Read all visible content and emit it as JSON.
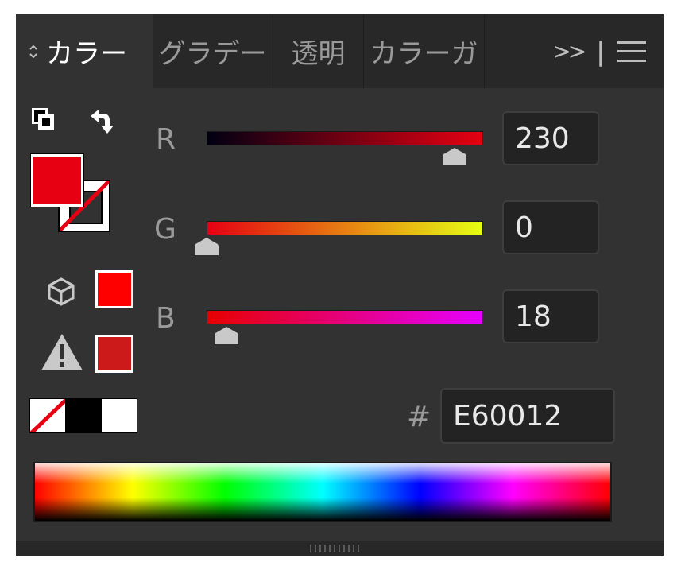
{
  "tabs": [
    {
      "label": "カラー",
      "active": true
    },
    {
      "label": "グラデー",
      "active": false
    },
    {
      "label": "透明",
      "active": false
    },
    {
      "label": "カラーガ",
      "active": false
    }
  ],
  "tab_menu": {
    "more_label": ">>",
    "separator": "|",
    "menu_icon": "hamburger-menu-icon"
  },
  "channels": [
    {
      "label": "R",
      "value": "230",
      "fraction": 0.902
    },
    {
      "label": "G",
      "value": "0",
      "fraction": 0.0
    },
    {
      "label": "B",
      "value": "18",
      "fraction": 0.071
    }
  ],
  "hex": {
    "prefix": "#",
    "value": "E60012"
  },
  "colors": {
    "fill": "#e60012",
    "web_safe": "#ff0000",
    "gamut_warning": "#cc1a1a",
    "panel_bg": "#323232"
  },
  "icons": {
    "default_colors": "default-fill-stroke-icon",
    "swap": "swap-fill-stroke-icon",
    "web_safe": "cube-icon",
    "gamut_warning": "warning-icon",
    "none_swatch": "none-swatch-icon"
  }
}
